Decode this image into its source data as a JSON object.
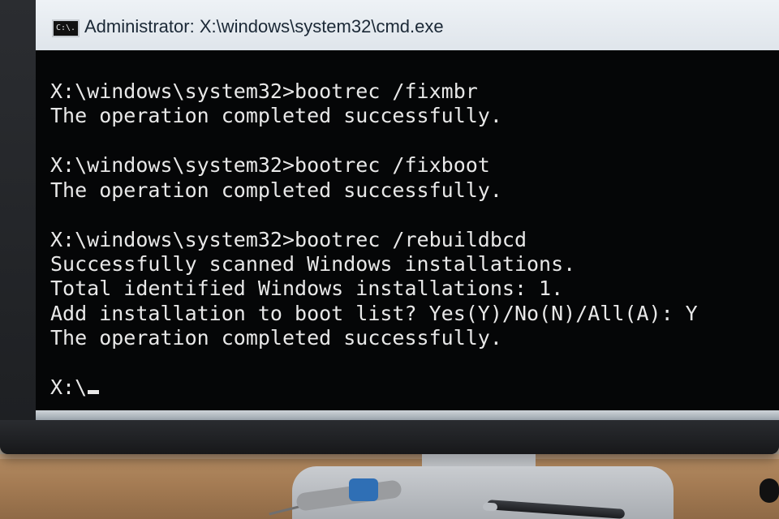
{
  "window": {
    "title": "Administrator: X:\\windows\\system32\\cmd.exe",
    "icon": "cmd-app-icon",
    "icon_text": "C:\\."
  },
  "console": {
    "lines": [
      "X:\\windows\\system32>bootrec /fixmbr",
      "The operation completed successfully.",
      "X:\\windows\\system32>bootrec /fixboot",
      "The operation completed successfully.",
      "X:\\windows\\system32>bootrec /rebuildbcd",
      "Successfully scanned Windows installations.",
      "Total identified Windows installations: 1.",
      "Add installation to boot list? Yes(Y)/No(N)/All(A): Y",
      "The operation completed successfully.",
      "X:\\"
    ],
    "background": "#050607",
    "text_color": "#e8e8e8"
  }
}
